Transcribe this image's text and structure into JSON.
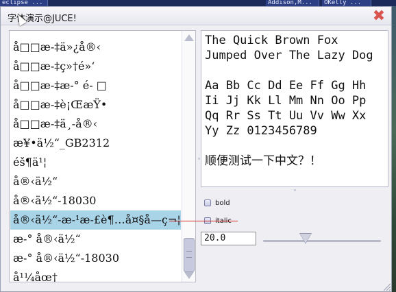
{
  "taskbar": {
    "items": [
      "eclipse ...",
      "Addison,M...",
      "OKelly ..."
    ]
  },
  "window": {
    "title": "字体演示@JUCE!",
    "close_glyph": "✖"
  },
  "font_list": {
    "items": [
      "å□□æ-‡ä»¿å®‹",
      "å□□æ-‡ç»†é»‘",
      "å□□æ-‡æ-° é- □",
      "å□□æ-‡è¡ŒæŸ•",
      "å□□æ-‡ä¸-å®‹",
      "æ¥•ä½“_GB2312",
      "éš¶ä¹¦",
      "å®‹ä½“",
      "å®‹ä½“-18030",
      "å®‹ä½“-æ-¹æ-£è¶…å¤§å­—ç¬¦é›†",
      "æ-° å®‹ä½“",
      "æ-° å®‹ä½“-18030",
      "å¹¼åœ†"
    ],
    "selected_index": 9
  },
  "preview": {
    "text": "The Quick Brown Fox\nJumped Over The Lazy Dog\n\nAa Bb Cc Dd Ee Ff Gg Hh\nIi Jj Kk Ll Mm Nn Oo Pp\nQq Rr Ss Tt Uu Vv Ww Xx\nYy Zz 0123456789\n\n顺便测试一下中文？！"
  },
  "controls": {
    "bold_label": "bold",
    "italic_label": "italic",
    "size_value": "20.0",
    "size_slider_fraction": 0.36
  },
  "colors": {
    "selection": "#a9d3e6",
    "close": "#d9534f",
    "annotation": "#d32020"
  }
}
